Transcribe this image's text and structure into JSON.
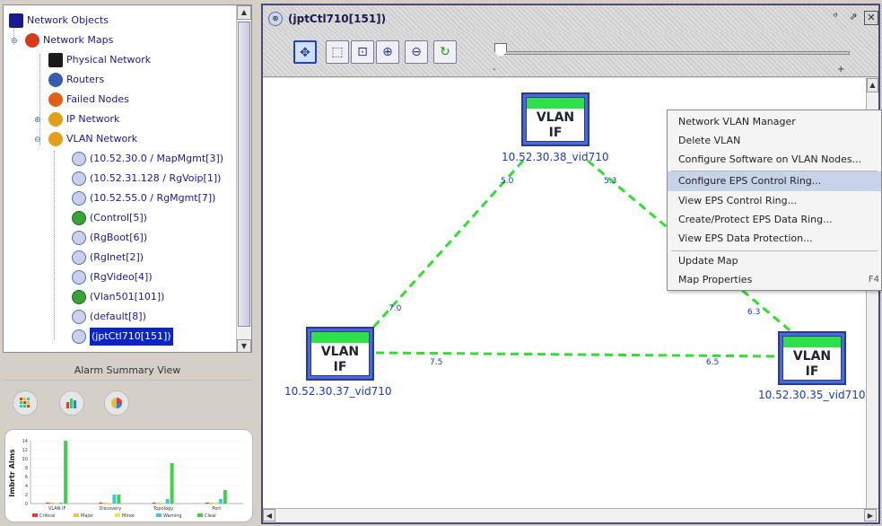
{
  "tree": {
    "items": [
      {
        "label": "Network Objects",
        "icon": "network-objects-icon",
        "color": "#1a1a8c"
      },
      {
        "label": "Network Maps",
        "icon": "network-maps-icon",
        "color": "#d63a1a"
      },
      {
        "label": "Physical Network",
        "icon": "physical-network-icon",
        "color": "#1a1a1a"
      },
      {
        "label": "Routers",
        "icon": "router-icon",
        "color": "#3a5ab0"
      },
      {
        "label": "Failed Nodes",
        "icon": "failed-nodes-icon",
        "color": "#e0601a"
      },
      {
        "label": "IP Network",
        "icon": "ip-network-icon",
        "color": "#e0a01a"
      },
      {
        "label": "VLAN Network",
        "icon": "vlan-network-icon",
        "color": "#e0a01a"
      },
      {
        "label": "(10.52.30.0 / MapMgmt[3])",
        "icon": "vlan-icon",
        "color": "#7a8ac0"
      },
      {
        "label": "(10.52.31.128 / RgVoip[1])",
        "icon": "vlan-icon",
        "color": "#7a8ac0"
      },
      {
        "label": "(10.52.55.0 / RgMgmt[7])",
        "icon": "vlan-icon",
        "color": "#7a8ac0"
      },
      {
        "label": "(Control[5])",
        "icon": "control-icon",
        "color": "#3aa03a"
      },
      {
        "label": "(RgBoot[6])",
        "icon": "vlan-icon",
        "color": "#7a8ac0"
      },
      {
        "label": "(RgInet[2])",
        "icon": "vlan-icon",
        "color": "#7a8ac0"
      },
      {
        "label": "(RgVideo[4])",
        "icon": "vlan-icon",
        "color": "#7a8ac0"
      },
      {
        "label": "(Vlan501[101])",
        "icon": "control-icon",
        "color": "#3aa03a"
      },
      {
        "label": "(default[8])",
        "icon": "vlan-icon",
        "color": "#7a8ac0"
      },
      {
        "label": "(jptCtl710[151])",
        "icon": "vlan-icon",
        "color": "#7a8ac0",
        "selected": true
      }
    ]
  },
  "alarm_summary": {
    "title": "Alarm Summary View"
  },
  "chart_data": {
    "type": "bar",
    "categories": [
      "VLAN IF",
      "Discovery",
      "Topology",
      "Port"
    ],
    "ylabel": "Imbrtr Alms",
    "ylim": [
      0,
      14
    ],
    "yticks": [
      0,
      2,
      4,
      6,
      8,
      10,
      12,
      14
    ],
    "series": [
      {
        "name": "Critical",
        "color": "#e83a3a",
        "values": [
          0,
          0,
          0,
          0
        ]
      },
      {
        "name": "Major",
        "color": "#f0c040",
        "values": [
          0,
          0,
          0,
          0
        ]
      },
      {
        "name": "Minor",
        "color": "#e8e860",
        "values": [
          0,
          0,
          0,
          0
        ]
      },
      {
        "name": "Warning",
        "color": "#40c8e0",
        "values": [
          0,
          2,
          1,
          1
        ]
      },
      {
        "name": "Clear",
        "color": "#40d050",
        "values": [
          14,
          2,
          9,
          3
        ]
      }
    ]
  },
  "map_window": {
    "title": "(jptCtl710[151])",
    "zoom_minus": "-",
    "zoom_plus": "+",
    "toolbar": [
      "select-tool-icon",
      "select-area-icon",
      "zoom-fit-icon",
      "zoom-in-icon",
      "zoom-out-icon",
      "refresh-icon"
    ]
  },
  "map": {
    "nodes": [
      {
        "id": "n38",
        "text": "VLAN IF",
        "label": "10.52.30.38_vid710"
      },
      {
        "id": "n37",
        "text": "VLAN IF",
        "label": "10.52.30.37_vid710"
      },
      {
        "id": "n35",
        "text": "VLAN IF",
        "label": "10.52.30.35_vid710"
      }
    ],
    "link_labels": [
      "5.0",
      "5.3",
      "7.0",
      "6.3",
      "7.5",
      "6.5"
    ],
    "link_color": "#33dd33"
  },
  "context_menu": {
    "items": [
      {
        "label": "Network VLAN Manager"
      },
      {
        "label": "Delete VLAN"
      },
      {
        "label": "Configure Software on VLAN Nodes..."
      },
      {
        "label": "Configure EPS Control Ring...",
        "highlighted": true
      },
      {
        "label": "View EPS Control Ring..."
      },
      {
        "label": "Create/Protect EPS Data Ring..."
      },
      {
        "label": "View EPS Data Protection..."
      },
      {
        "label": "Update Map"
      },
      {
        "label": "Map Properties",
        "shortcut": "F4"
      }
    ]
  }
}
